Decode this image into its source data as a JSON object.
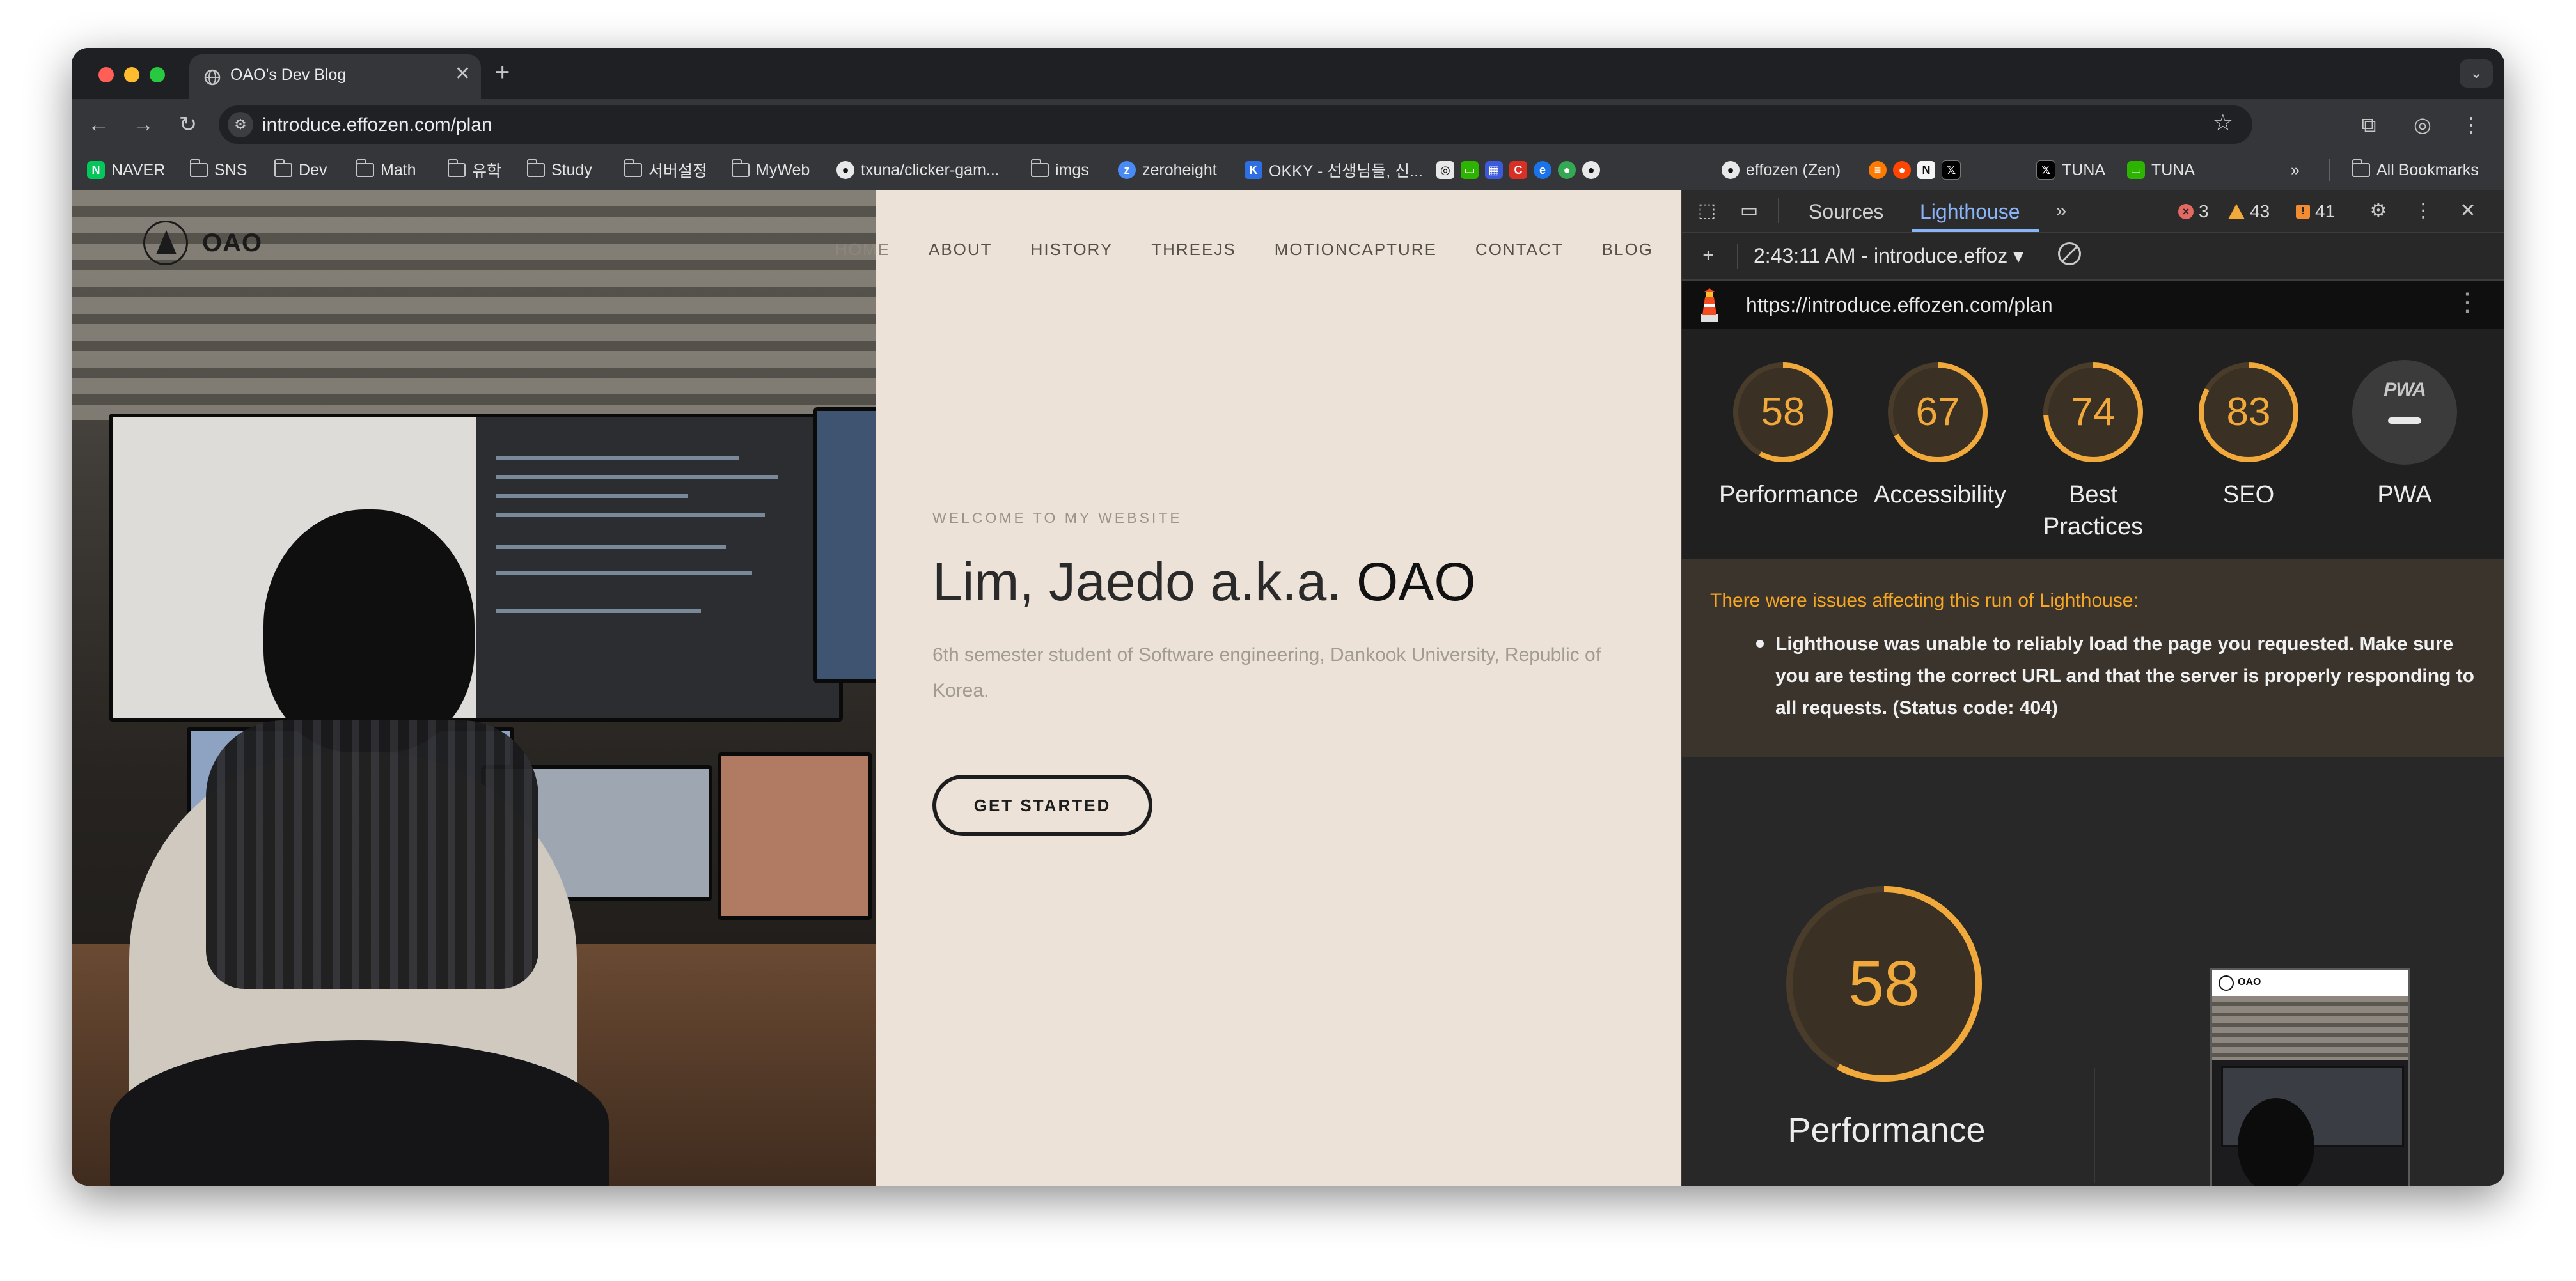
{
  "browser": {
    "tab": {
      "title": "OAO's Dev Blog"
    },
    "new_tab": "+",
    "omnibox": {
      "url": "introduce.effozen.com/plan"
    },
    "bookmarks": [
      {
        "label": "NAVER",
        "kind": "naver"
      },
      {
        "label": "SNS",
        "kind": "folder"
      },
      {
        "label": "Dev",
        "kind": "folder"
      },
      {
        "label": "Math",
        "kind": "folder"
      },
      {
        "label": "유학",
        "kind": "folder"
      },
      {
        "label": "Study",
        "kind": "folder"
      },
      {
        "label": "서버설정",
        "kind": "folder"
      },
      {
        "label": "MyWeb",
        "kind": "folder"
      },
      {
        "label": "txuna/clicker-gam...",
        "kind": "github"
      },
      {
        "label": "imgs",
        "kind": "folder"
      },
      {
        "label": "zeroheight",
        "kind": "zeroheight"
      },
      {
        "label": "OKKY - 선생님들, 신...",
        "kind": "okky"
      },
      {
        "label": "effozen (Zen)",
        "kind": "github"
      },
      {
        "label": "TUNA",
        "kind": "x"
      },
      {
        "label": "TUNA",
        "kind": "tuna"
      }
    ],
    "all_bookmarks": "All Bookmarks"
  },
  "website": {
    "logo_text": "OAO",
    "nav": [
      "HOME",
      "ABOUT",
      "HISTORY",
      "THREEJS",
      "MOTIONCAPTURE",
      "CONTACT",
      "BLOG"
    ],
    "welcome": "WELCOME TO MY WEBSITE",
    "title_name": "Lim, Jaedo a.k.a.",
    "title_alias": "OAO",
    "description": "6th semester student of Software engineering, Dankook University, Republic of Korea.",
    "cta": "GET STARTED"
  },
  "devtools": {
    "tabs": [
      "Sources",
      "Lighthouse"
    ],
    "active_tab": "Lighthouse",
    "counts": {
      "errors": "3",
      "warnings": "43",
      "issues": "41"
    },
    "report_label": "2:43:11 AM - introduce.effoz",
    "lighthouse_url": "https://introduce.effozen.com/plan",
    "scores": [
      {
        "label": "Performance",
        "value": 58
      },
      {
        "label": "Accessibility",
        "value": 67
      },
      {
        "label": "Best Practices",
        "value": 74
      },
      {
        "label": "SEO",
        "value": 83
      }
    ],
    "pwa": {
      "label": "PWA",
      "badge": "PWA"
    },
    "warning": {
      "heading": "There were issues affecting this run of Lighthouse:",
      "item": "Lighthouse was unable to reliably load the page you requested. Make sure you are testing the correct URL and that the server is properly responding to all requests. (Status code: 404)"
    },
    "main_score": {
      "label": "Performance",
      "value": 58
    },
    "thumbnail_title": "OAO",
    "gauge_color": "#f0a93a",
    "gauge_track": "#4a3c2b"
  }
}
